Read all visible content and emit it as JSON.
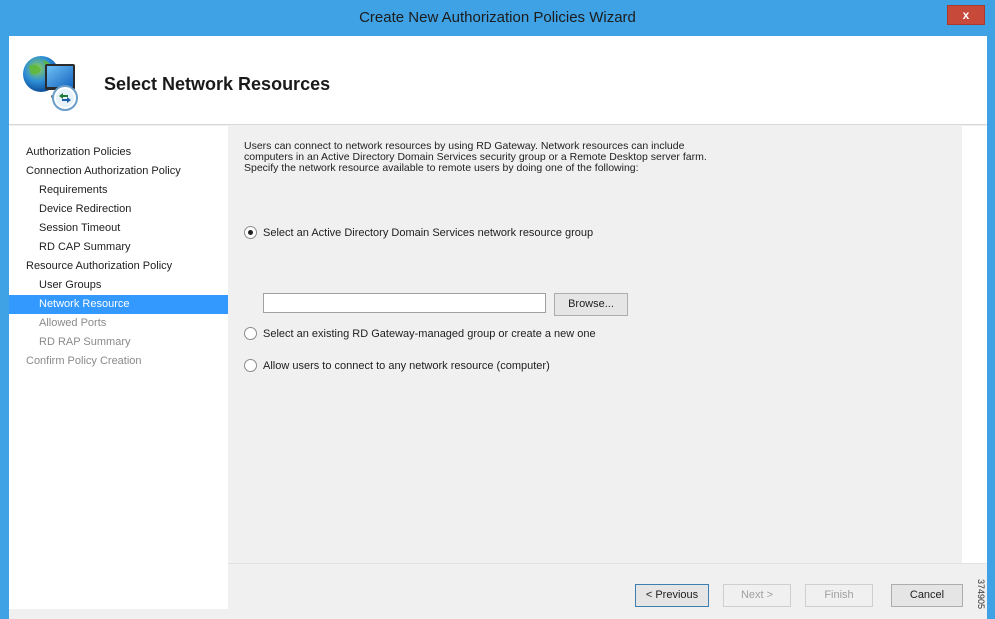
{
  "window": {
    "title": "Create New Authorization Policies Wizard",
    "close_label": "x",
    "accent_color": "#3fa2e5"
  },
  "header": {
    "title": "Select Network Resources",
    "icon": "computer-remote-icon"
  },
  "nav": {
    "items": [
      {
        "label": "Authorization Policies",
        "level": 0,
        "state": "normal"
      },
      {
        "label": "Connection Authorization Policy",
        "level": 0,
        "state": "normal"
      },
      {
        "label": "Requirements",
        "level": 1,
        "state": "normal"
      },
      {
        "label": "Device Redirection",
        "level": 1,
        "state": "normal"
      },
      {
        "label": "Session Timeout",
        "level": 1,
        "state": "normal"
      },
      {
        "label": "RD CAP Summary",
        "level": 1,
        "state": "normal"
      },
      {
        "label": "Resource Authorization Policy",
        "level": 0,
        "state": "normal"
      },
      {
        "label": "User Groups",
        "level": 1,
        "state": "normal"
      },
      {
        "label": "Network Resource",
        "level": 1,
        "state": "selected"
      },
      {
        "label": "Allowed Ports",
        "level": 1,
        "state": "disabled"
      },
      {
        "label": "RD RAP Summary",
        "level": 1,
        "state": "disabled"
      },
      {
        "label": "Confirm Policy Creation",
        "level": 0,
        "state": "disabled"
      }
    ],
    "selected_color": "#3399ff"
  },
  "content": {
    "intro_line1": "Users can connect to network resources by using RD Gateway. Network resources can include",
    "intro_line2": "computers in an Active Directory Domain Services security group or a Remote Desktop server farm.",
    "intro_line3": "Specify the network resource available to remote users by doing one of the following:",
    "options": [
      {
        "label": "Select an Active Directory Domain Services network resource group",
        "checked": true
      },
      {
        "label": "Select an existing RD Gateway-managed group or create a new one",
        "checked": false
      },
      {
        "label": "Allow users to connect to any network resource (computer)",
        "checked": false
      }
    ],
    "group_input_value": "",
    "browse_label": "Browse..."
  },
  "footer": {
    "previous_label": "< Previous",
    "next_label": "Next >",
    "finish_label": "Finish",
    "cancel_label": "Cancel"
  },
  "watermark": "374905"
}
